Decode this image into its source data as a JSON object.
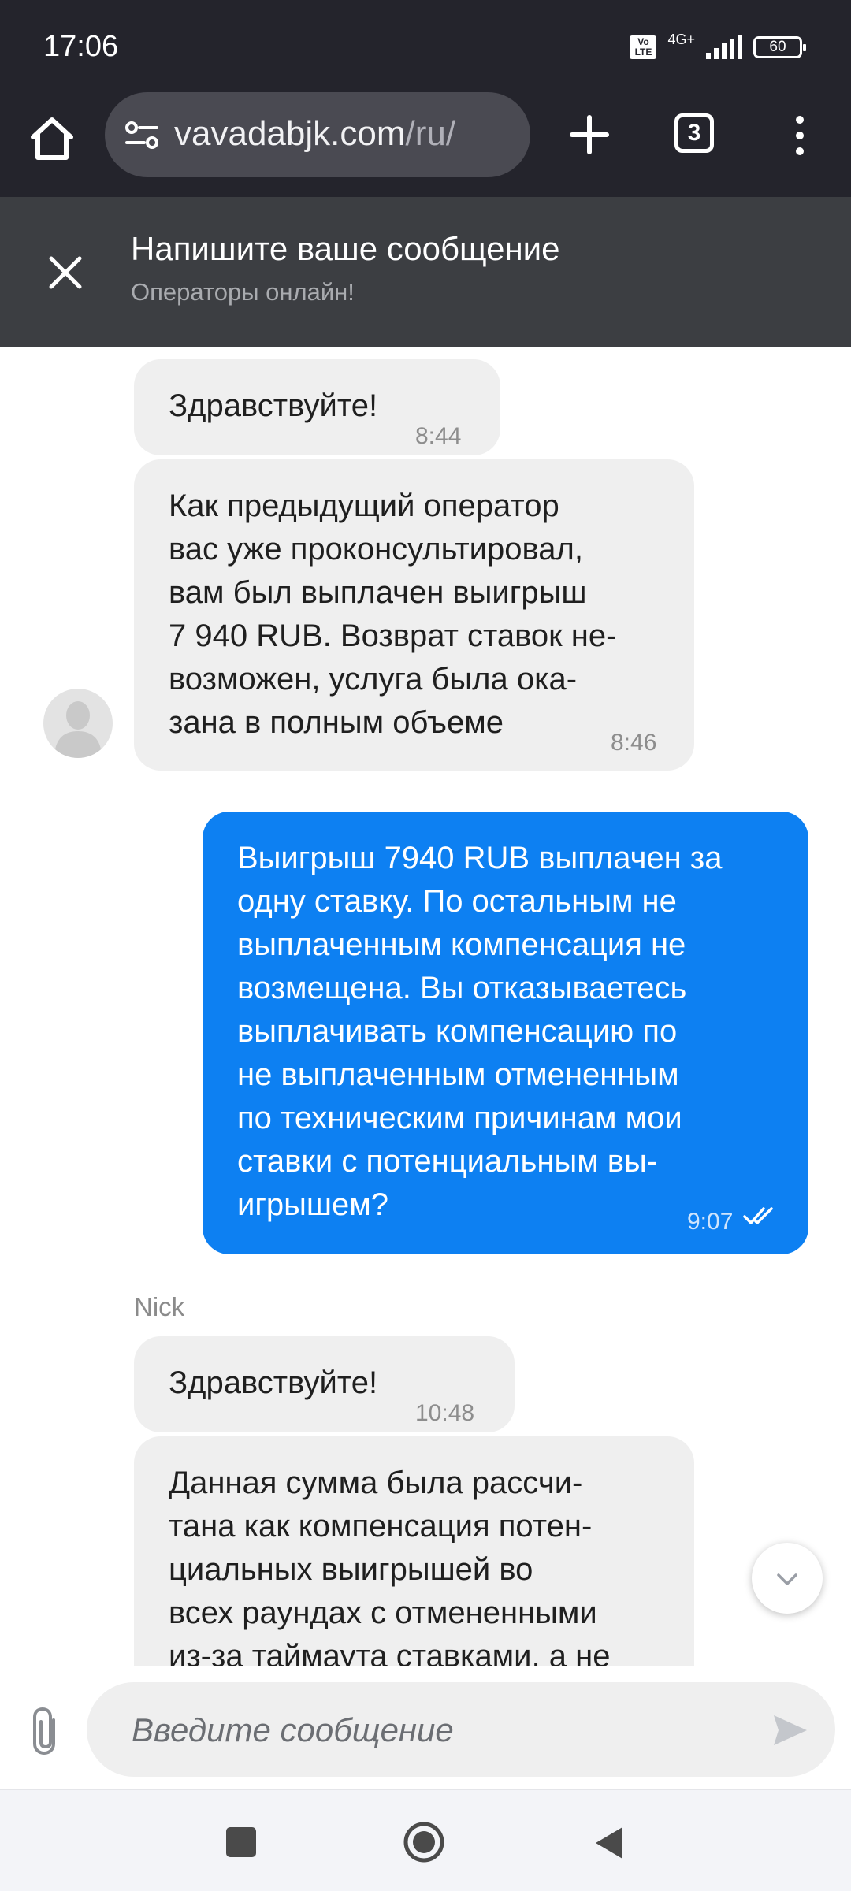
{
  "status_bar": {
    "time": "17:06",
    "volte_label": "Vo LTE",
    "network": "4G+",
    "battery": "60"
  },
  "browser": {
    "url_domain": "vavadabjk.com",
    "url_path": "/ru/",
    "tab_count": "3"
  },
  "chat_header": {
    "title": "Напишите ваше сообщение",
    "subtitle": "Операторы онлайн!"
  },
  "messages": [
    {
      "direction": "in",
      "text": "Здравствуйте!",
      "time": "8:44"
    },
    {
      "direction": "in",
      "text": "Как предыдущий оператор\nвас уже проконсультировал,\nвам был выплачен выигрыш\n7 940 RUB. Возврат ставок не-\nвозможен, услуга была ока-\nзана в полным объеме",
      "time": "8:46"
    },
    {
      "direction": "out",
      "text": "Выигрыш 7940 RUB выплачен за\nодну ставку. По остальным не\nвыплаченным компенсация не\nвозмещена. Вы отказываетесь\nвыплачивать компенсацию по\nне выплаченным отмененным\nпо техническим причинам мои\nставки с потенциальным вы-\nигрышем?",
      "time": "9:07",
      "read": true
    },
    {
      "direction": "in",
      "text": "Здравствуйте!",
      "time": "10:48"
    },
    {
      "direction": "in",
      "text": "Данная сумма была рассчи-\nтана как компенсация потен-\nциальных выигрышей во\nвсех раундах с отмененными\nиз-за таймаута ставками, а не",
      "time": ""
    }
  ],
  "sender_name": "Nick",
  "composer": {
    "placeholder": "Введите сообщение"
  },
  "colors": {
    "outgoing_bubble": "#0d80f2",
    "incoming_bubble": "#efefef",
    "header_bg": "#3c3e42",
    "toolbar_bg": "#24242c"
  },
  "icons": [
    "home-icon",
    "site-settings-icon",
    "plus-icon",
    "tabs-icon",
    "more-vert-icon",
    "close-icon",
    "avatar-icon",
    "double-check-icon",
    "chevron-down-icon",
    "paperclip-icon",
    "send-icon",
    "nav-recents-icon",
    "nav-home-icon",
    "nav-back-icon"
  ]
}
